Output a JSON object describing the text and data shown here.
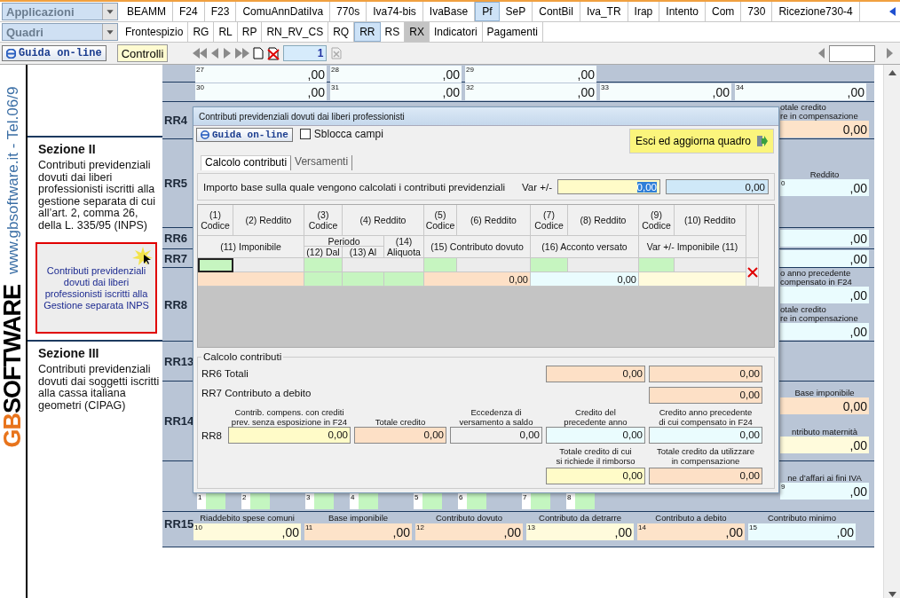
{
  "toolbar": {
    "applications": {
      "label": "Applicazioni",
      "tabs": [
        {
          "label": "BEAMM",
          "selected": false
        },
        {
          "label": "F24",
          "selected": false
        },
        {
          "label": "F23",
          "selected": false
        },
        {
          "label": "ComuAnnDatiIva",
          "selected": false
        },
        {
          "label": "770s",
          "selected": false
        },
        {
          "label": "Iva74-bis",
          "selected": false
        },
        {
          "label": "IvaBase",
          "selected": false
        },
        {
          "label": "Pf",
          "selected": true
        },
        {
          "label": "SeP",
          "selected": false
        },
        {
          "label": "ContBil",
          "selected": false
        },
        {
          "label": "Iva_TR",
          "selected": false
        },
        {
          "label": "Irap",
          "selected": false
        },
        {
          "label": "Intento",
          "selected": false
        },
        {
          "label": "Com",
          "selected": false
        },
        {
          "label": "730",
          "selected": false
        },
        {
          "label": "Ricezione730-4",
          "selected": false
        }
      ]
    },
    "quadri": {
      "label": "Quadri",
      "tabs": [
        {
          "label": "Frontespizio",
          "selected": false,
          "highlighted": false
        },
        {
          "label": "RG",
          "selected": false,
          "highlighted": false
        },
        {
          "label": "RL",
          "selected": false,
          "highlighted": false
        },
        {
          "label": "RP",
          "selected": false,
          "highlighted": false
        },
        {
          "label": "RN_RV_CS",
          "selected": false,
          "highlighted": false
        },
        {
          "label": "RQ",
          "selected": false,
          "highlighted": false
        },
        {
          "label": "RR",
          "selected": true,
          "highlighted": false
        },
        {
          "label": "RS",
          "selected": false,
          "highlighted": false
        },
        {
          "label": "RX",
          "selected": false,
          "highlighted": true
        },
        {
          "label": "Indicatori",
          "selected": false,
          "highlighted": false
        },
        {
          "label": "Pagamenti",
          "selected": false,
          "highlighted": false
        }
      ]
    },
    "guide_button": "Guida on-line",
    "controls_button": "Controlli",
    "page": "1"
  },
  "sidebar": {
    "website": "www.gbsoftware.it - Tel.06/9",
    "logo_mark": "GB",
    "logo_text": "SOFTWARE",
    "sections": [
      {
        "title": "Sezione II",
        "text": "Contributi previdenziali dovuti dai liberi professionisti iscritti alla gestione separata di cui all’art. 2, comma 26, della L. 335/95 (INPS)",
        "button": "Contributi previdenziali dovuti dai liberi professionisti iscritti alla Gestione separata INPS"
      },
      {
        "title": "Sezione III",
        "text": "Contributi previdenziali dovuti dai soggetti iscritti alla cassa italiana geometri (CIPAG)"
      }
    ]
  },
  "form": {
    "rows": [
      {
        "kind": "fields",
        "fields": [
          {
            "number": "27",
            "value": ",00",
            "color": "#f6fdfd"
          },
          {
            "number": "28",
            "value": ",00",
            "color": "#f6fdfd"
          },
          {
            "number": "29",
            "value": ",00",
            "color": "#f6fdfd"
          }
        ]
      },
      {
        "kind": "fields",
        "fields": [
          {
            "number": "30",
            "value": ",00",
            "color": "#f6fdfd"
          },
          {
            "number": "31",
            "value": ",00",
            "color": "#f6fdfd"
          },
          {
            "number": "32",
            "value": ",00",
            "color": "#f6fdfd"
          },
          {
            "number": "33",
            "value": ",00",
            "color": "#f6fdfd"
          },
          {
            "number": "34",
            "value": ",00",
            "color": "#f6fdfd"
          }
        ]
      },
      {
        "kind": "line",
        "code": "RR4",
        "right": [
          {
            "caption": "otale credito\nre in compensazione",
            "value": "0,00",
            "color": "#fde3c9"
          }
        ]
      },
      {
        "kind": "line",
        "code": "RR5",
        "right": [
          {
            "caption": "Reddito",
            "number": "0",
            "value": ",00",
            "color": "#eafcfe"
          }
        ]
      },
      {
        "kind": "line",
        "code": "RR6",
        "right": [
          {
            "value": ",00",
            "color": "#eafcfe"
          }
        ]
      },
      {
        "kind": "line",
        "code": "RR7",
        "right": [
          {
            "value": ",00",
            "color": "#eafcfe"
          }
        ]
      },
      {
        "kind": "line",
        "code": "RR8",
        "right": [
          {
            "caption": "o anno precedente\ncompensato in F24",
            "value": ",00",
            "color": "#eafcfe"
          },
          {
            "caption": "otale credito\nre in compensazione",
            "value": ",00",
            "color": "#eafcfe"
          }
        ]
      },
      {
        "kind": "line",
        "code": "RR13"
      },
      {
        "kind": "line",
        "code": "RR14",
        "right": [
          {
            "caption": "Base imponibile",
            "value": "0,00",
            "color": "#fde3c9"
          },
          {
            "caption": "ntributo maternità",
            "value": ",00",
            "color": "#fffbdc"
          }
        ]
      },
      {
        "kind": "boxes",
        "boxes": [
          {
            "number": "1"
          },
          {
            "number": "2"
          },
          {
            "number": "3"
          },
          {
            "number": "4"
          },
          {
            "number": "5"
          },
          {
            "number": "6"
          },
          {
            "number": "7"
          },
          {
            "number": "8"
          }
        ],
        "right": [
          {
            "caption": "ne d’affari ai fini IVA",
            "number": "9",
            "value": ",00",
            "color": "#eafcfe"
          }
        ]
      },
      {
        "kind": "captioned",
        "code": "RR15",
        "fields": [
          {
            "caption": "Riaddebito spese comuni",
            "number": "10",
            "value": ",00",
            "color": "#fffbdc"
          },
          {
            "caption": "Base imponibile",
            "number": "11",
            "value": ",00",
            "color": "#fde3c9"
          },
          {
            "caption": "Contributo dovuto",
            "number": "12",
            "value": ",00",
            "color": "#fde3c9"
          },
          {
            "caption": "Contributo da detrarre",
            "number": "13",
            "value": ",00",
            "color": "#fffbdc"
          },
          {
            "caption": "Contributo a debito",
            "number": "14",
            "value": ",00",
            "color": "#fde3c9"
          },
          {
            "caption": "Contributo minimo",
            "number": "15",
            "value": ",00",
            "color": "#eafcfe"
          }
        ]
      }
    ]
  },
  "dialog": {
    "title": "Contributi previdenziali dovuti dai liberi professionisti",
    "guide_button": "Guida on-line",
    "unlock": {
      "label": "Sblocca campi",
      "checked": false
    },
    "exit_button": "Esci ed aggiorna quadro",
    "tabs": [
      {
        "label": "Calcolo contributi",
        "selected": true
      },
      {
        "label": "Versamenti",
        "selected": false
      }
    ],
    "base": {
      "label": "Importo base sulla quale vengono calcolati i contributi previdenziali",
      "var_label": "Var +/-",
      "var_value": "0,00",
      "var_focused": true,
      "value": "0,00"
    },
    "grid": {
      "header_1": [
        "(1)\nCodice",
        "(2) Reddito",
        "(3)\nCodice",
        "(4) Reddito",
        "(5)\nCodice",
        "(6) Reddito",
        "(7)\nCodice",
        "(8) Reddito",
        "(9)\nCodice",
        "(10) Reddito"
      ],
      "header_2": {
        "imponibile": "(11) Imponibile",
        "periodo": "Periodo",
        "dal": "(12) Dal",
        "al": "(13) Al",
        "aliquota": "(14)\nAliquota",
        "dovuto": "(15) Contributo dovuto",
        "acconto": "(16) Acconto versato",
        "var": "Var +/- Imponibile (11)"
      },
      "rows": [
        {
          "dovuto": "0,00",
          "acconto": "0,00"
        }
      ]
    },
    "totals": {
      "legend": "Calcolo contributi",
      "rr6": {
        "label": "RR6 Totali",
        "values": [
          "0,00",
          "0,00"
        ]
      },
      "rr7": {
        "label": "RR7 Contributo a debito",
        "value": "0,00"
      },
      "rr8": {
        "label": "RR8",
        "fields": [
          {
            "caption": "Contrib. compens. con crediti\nprev. senza esposizione in F24",
            "value": "0,00",
            "color": "#fffbc8"
          },
          {
            "caption": "Totale credito",
            "value": "0,00",
            "color": "#fde0c6"
          },
          {
            "caption": "Eccedenza di\nversamento a saldo",
            "value": "0,00",
            "color": "#f0f0f0"
          },
          {
            "caption": "Credito del\nprecedente anno",
            "value": "0,00",
            "color": "#eafcfe"
          },
          {
            "caption": "Credito anno precedente\ndi cui compensato in F24",
            "value": "0,00",
            "color": "#eafcfe"
          }
        ],
        "fields_2": [
          {
            "caption": "Totale credito di cui\nsi richiede il rimborso",
            "value": "0,00",
            "color": "#fffbc8"
          },
          {
            "caption": "Totale credito da utilizzare\nin compensazione",
            "value": "0,00",
            "color": "#fde0c6"
          }
        ]
      }
    }
  }
}
